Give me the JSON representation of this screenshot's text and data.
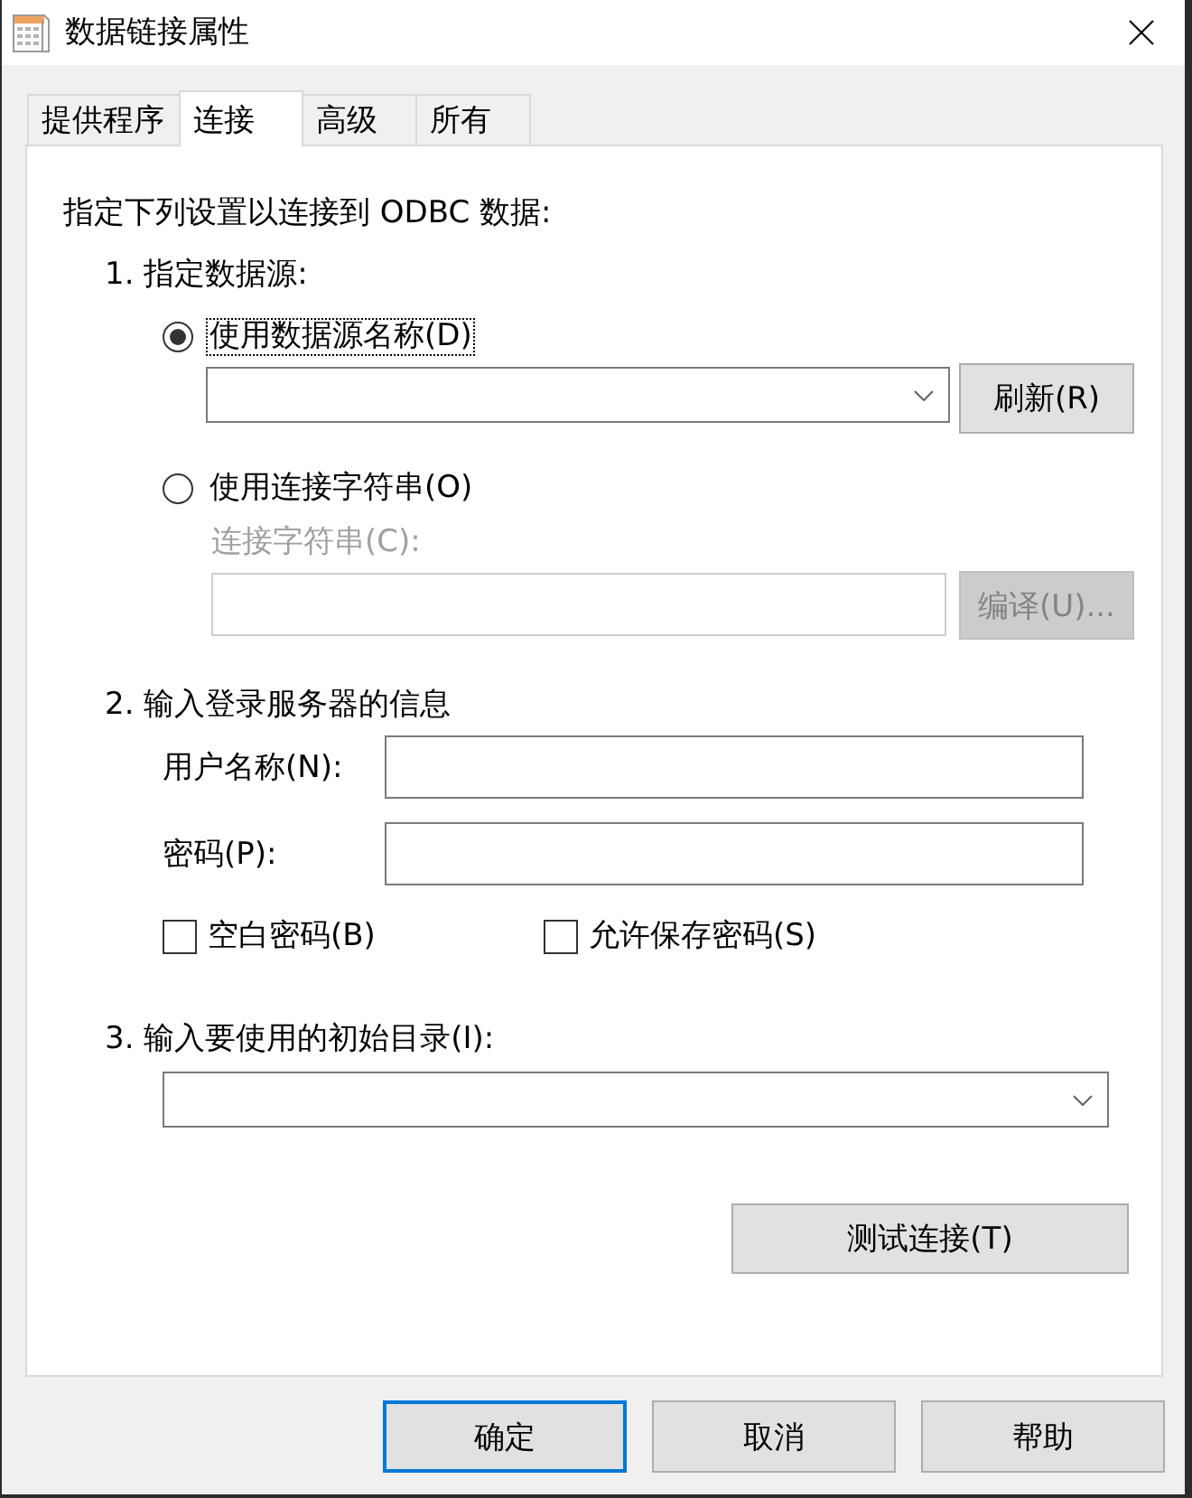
{
  "window": {
    "title": "数据链接属性"
  },
  "tabs": [
    {
      "label": "提供程序",
      "selected": false
    },
    {
      "label": "连接",
      "selected": true
    },
    {
      "label": "高级",
      "selected": false
    },
    {
      "label": "所有",
      "selected": false
    }
  ],
  "connection": {
    "intro": "指定下列设置以连接到 ODBC 数据:",
    "data_source": {
      "heading": "1. 指定数据源:",
      "items": [
        {
          "kind": "radio",
          "label": "使用数据源名称(D)",
          "selected": true,
          "focused": true
        },
        {
          "kind": "dropdown_with_button",
          "disabled": false,
          "button": {
            "label": "刷新(R)",
            "disabled": false
          }
        },
        {
          "kind": "radio",
          "label": "使用连接字符串(O)",
          "selected": false,
          "focused": false
        },
        {
          "kind": "caption",
          "label": "连接字符串(C):",
          "disabled": true
        },
        {
          "kind": "field_with_button",
          "disabled": true,
          "button": {
            "label": "编译(U)...",
            "disabled": true
          }
        }
      ]
    },
    "login": {
      "heading": "2. 输入登录服务器的信息",
      "fields": [
        {
          "label": "用户名称(N):"
        },
        {
          "label": "密码(P):"
        }
      ],
      "checkboxes": [
        {
          "label": "空白密码(B)",
          "checked": false
        },
        {
          "label": "允许保存密码(S)",
          "checked": false
        }
      ]
    },
    "catalog": {
      "heading": "3. 输入要使用的初始目录(I):"
    },
    "test_button": {
      "label": "测试连接(T)"
    }
  },
  "buttons": [
    {
      "label": "确定",
      "default": true
    },
    {
      "label": "取消",
      "default": false
    },
    {
      "label": "帮助",
      "default": false
    }
  ]
}
